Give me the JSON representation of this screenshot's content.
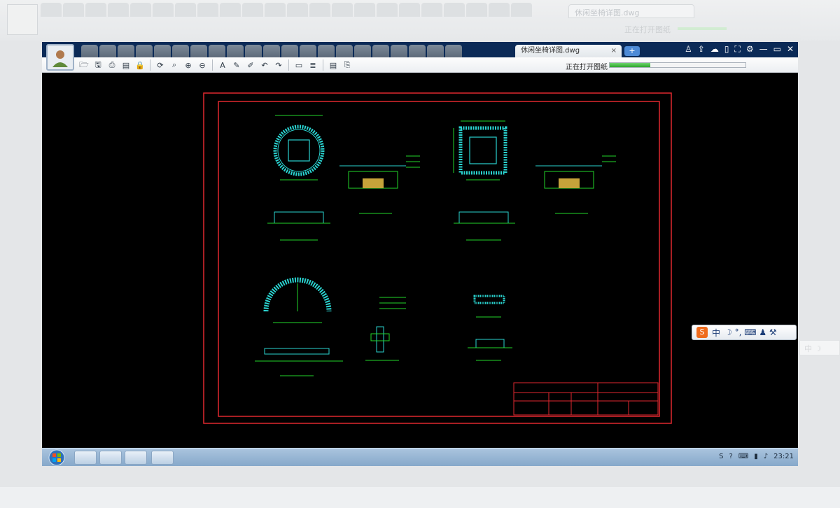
{
  "window": {
    "active_tab_title": "休闲坐椅详图.dwg",
    "close_tab_glyph": "×",
    "new_tab_glyph": "+",
    "doc_tab_count": 21,
    "status_text": "正在打开图纸",
    "progress": 0.3
  },
  "controls": {
    "minimize": "—",
    "maximize": "▭",
    "close": "✕"
  },
  "toolbar": {
    "icons": [
      "open-icon",
      "save-icon",
      "print-icon",
      "pdf-icon",
      "lock-icon",
      "refresh-icon",
      "zoom-window-icon",
      "zoom-in-icon",
      "zoom-out-icon",
      "text-icon",
      "pencil-icon",
      "marker-icon",
      "undo-icon",
      "redo-icon",
      "measure-icon",
      "hatch-icon",
      "layers-icon",
      "export-icon"
    ],
    "glyphs": [
      "🗁",
      "🖫",
      "⎙",
      "▤",
      "🔒",
      "⟳",
      "⌕",
      "⊕",
      "⊖",
      "A",
      "✎",
      "✐",
      "↶",
      "↷",
      "▭",
      "≣",
      "▤",
      "⎘"
    ]
  },
  "ime": {
    "logo": "S",
    "label": "中",
    "extra": "☽ °, ⌨ ♟ ⚒"
  },
  "taskbar": {
    "clock": "23:21"
  },
  "ghost": {
    "title": "休闲坐椅详图.dwg",
    "status": "正在打开图纸",
    "ime_label": "中 ☽"
  },
  "colors": {
    "frame_red": "#e0282f",
    "cad_green": "#22d62a",
    "cad_cyan": "#2ad3d0",
    "titlebar": "#0b2a57"
  }
}
